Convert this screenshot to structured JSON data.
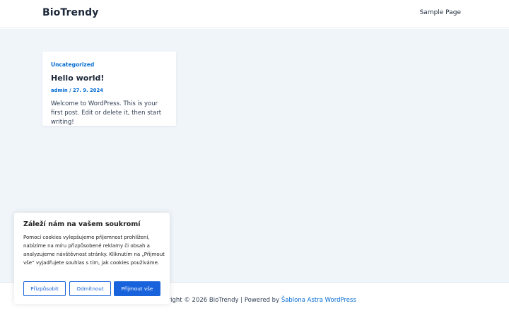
{
  "header": {
    "site_title": "BioTrendy",
    "nav": [
      "Sample Page"
    ]
  },
  "post": {
    "category": "Uncategorized",
    "title": "Hello world!",
    "author": "admin",
    "separator": "/",
    "date": "27. 9. 2024",
    "excerpt": "Welcome to WordPress. This is your first post. Edit or delete it, then start writing!"
  },
  "footer": {
    "copyright": "Copyright © 2026 BioTrendy | Powered by ",
    "theme_link": "Šablona Astra WordPress"
  },
  "cookie": {
    "title": "Záleží nám na vašem soukromí",
    "text": "Pomocí cookies vylepšujeme příjemnost prohlížení, nabízíme na míru přizpůsobené reklamy či obsah a analyzujeme návštěvnost stránky. Kliknutím na „Přijmout vše“ vyjadřujete souhlas s tím, jak cookies používáme.",
    "customize_label": "Přizpůsobit",
    "reject_label": "Odmítnout",
    "accept_label": "Přijmout vše"
  },
  "colors": {
    "accent": "#046bd2",
    "cookie_accent": "#1863dc",
    "content_bg": "#f0f5fa"
  }
}
